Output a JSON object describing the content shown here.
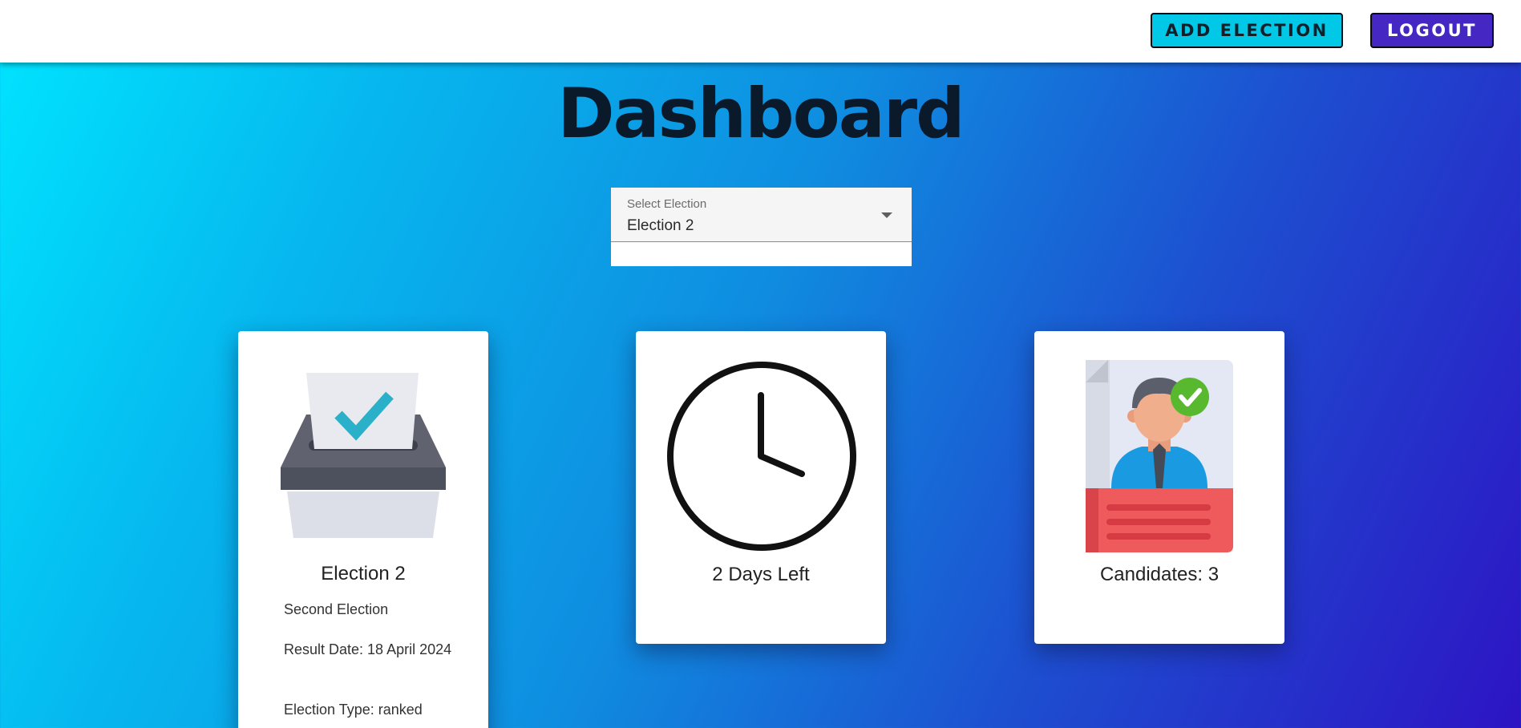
{
  "header": {
    "add_election_label": "ADD ELECTION",
    "logout_label": "LOGOUT"
  },
  "page": {
    "title": "Dashboard"
  },
  "select": {
    "label": "Select Election",
    "value": "Election 2"
  },
  "cards": {
    "election": {
      "icon": "ballot-box-icon",
      "title": "Election 2",
      "description": "Second Election",
      "result_date": "Result Date: 18 April 2024",
      "election_type": "Election Type: ranked"
    },
    "time": {
      "icon": "clock-icon",
      "title": "2 Days Left"
    },
    "candidates": {
      "icon": "candidate-profile-icon",
      "title": "Candidates: 3"
    }
  },
  "colors": {
    "add_button": "#00c8e6",
    "logout_button": "#4527c4",
    "gradient_start": "#00e5ff",
    "gradient_end": "#2d14c4"
  }
}
